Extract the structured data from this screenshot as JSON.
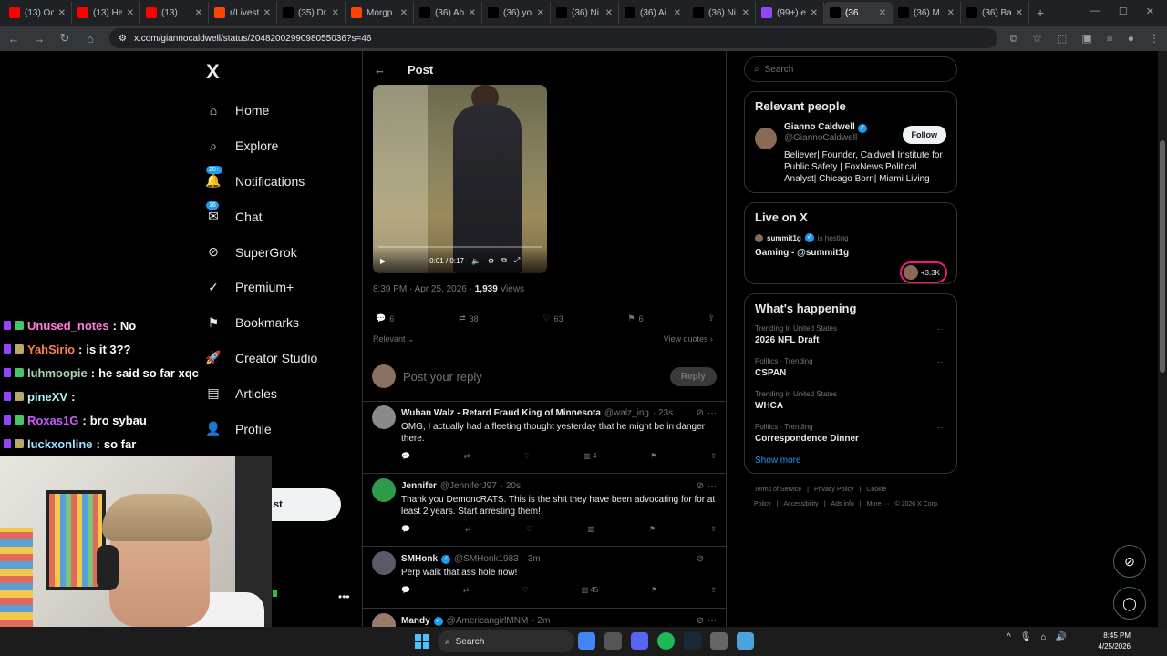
{
  "browser": {
    "tabs": [
      {
        "title": "(13) Oc",
        "favicon": "youtube-icon",
        "color": "#ff0000"
      },
      {
        "title": "(13) He",
        "favicon": "youtube-icon",
        "color": "#ff0000"
      },
      {
        "title": "(13)",
        "favicon": "youtube-icon",
        "color": "#ff0000"
      },
      {
        "title": "r/Livest",
        "favicon": "reddit-icon",
        "color": "#ff4500"
      },
      {
        "title": "(35) Dr",
        "favicon": "x-icon",
        "color": "#000000"
      },
      {
        "title": "Morgp",
        "favicon": "reddit-icon",
        "color": "#ff4500"
      },
      {
        "title": "(36) Ah",
        "favicon": "x-icon",
        "color": "#000000"
      },
      {
        "title": "(36) yo",
        "favicon": "x-icon",
        "color": "#000000"
      },
      {
        "title": "(36) Ni",
        "favicon": "x-icon",
        "color": "#000000"
      },
      {
        "title": "(36) Ai",
        "favicon": "x-icon",
        "color": "#000000"
      },
      {
        "title": "(36) Ni",
        "favicon": "x-icon",
        "color": "#000000"
      },
      {
        "title": "(99+) e",
        "favicon": "twitch-icon",
        "color": "#9146ff"
      },
      {
        "title": "(36",
        "favicon": "x-icon",
        "color": "#000000",
        "active": true
      },
      {
        "title": "(36) M",
        "favicon": "x-icon",
        "color": "#000000"
      },
      {
        "title": "(36) Ba",
        "favicon": "x-icon",
        "color": "#000000"
      }
    ],
    "url": "x.com/giannocaldwell/status/2048200299098055036?s=46"
  },
  "sidebar": {
    "logo": "X",
    "items": [
      {
        "label": "Home",
        "icon": "home-icon"
      },
      {
        "label": "Explore",
        "icon": "search-icon"
      },
      {
        "label": "Notifications",
        "icon": "bell-icon",
        "badge": "20+"
      },
      {
        "label": "Chat",
        "icon": "chat-icon",
        "badge": "16"
      },
      {
        "label": "SuperGrok",
        "icon": "grok-icon"
      },
      {
        "label": "Premium+",
        "icon": "premium-icon"
      },
      {
        "label": "Bookmarks",
        "icon": "bookmark-icon"
      },
      {
        "label": "Creator Studio",
        "icon": "rocket-icon"
      },
      {
        "label": "Articles",
        "icon": "article-icon"
      },
      {
        "label": "Profile",
        "icon": "person-icon"
      }
    ],
    "post_button": "st"
  },
  "post": {
    "header": "Post",
    "video_time": "0:01 / 0:17",
    "timestamp": "8:39 PM · Apr 25, 2026 ·",
    "views_count": "1,939",
    "views_label": "Views",
    "replies": "6",
    "reposts": "38",
    "likes": "63",
    "bookmarks": "6",
    "sort_label": "Relevant",
    "view_quotes": "View quotes",
    "reply_placeholder": "Post your reply",
    "reply_button": "Reply"
  },
  "replies": [
    {
      "name": "Wuhan Walz - Retard Fraud King of Minnesota",
      "handle": "@walz_ing",
      "time": "· 23s",
      "text": "OMG, I actually had a fleeting thought yesterday that he might be in danger there.",
      "views": "4",
      "avatar_color": "#8a8a8a",
      "verified": false
    },
    {
      "name": "Jennifer",
      "handle": "@JenniferJ97",
      "time": "· 20s",
      "text": "Thank you DemoncRATS. This is the shit they have been advocating for for at least 2 years. Start arresting them!",
      "views": "",
      "avatar_color": "#2e9b4a",
      "verified": false
    },
    {
      "name": "SMHonk",
      "handle": "@SMHonk1983",
      "time": "· 3m",
      "text": "Perp walk that ass hole now!",
      "views": "45",
      "avatar_color": "#5a5a6a",
      "verified": true
    },
    {
      "name": "Mandy",
      "handle": "@AmericangirlMNM",
      "time": "· 2m",
      "text": "",
      "views": "",
      "avatar_color": "#9a7a6a",
      "verified": true
    }
  ],
  "right": {
    "search_placeholder": "Search",
    "relevant_people": {
      "title": "Relevant people",
      "name": "Gianno Caldwell",
      "handle": "@GiannoCaldwell",
      "follow": "Follow",
      "bio": "Believer| Founder, Caldwell Institute for Public Safety | FoxNews Political Analyst| Chicago Born| Miami Living"
    },
    "live": {
      "title": "Live on X",
      "host": "summit1g",
      "hosting": "is hosting",
      "stream_title": "Gaming - @summit1g",
      "listeners": "+3.3K"
    },
    "happening": {
      "title": "What's happening",
      "trends": [
        {
          "meta": "Trending in United States",
          "name": "2026 NFL Draft"
        },
        {
          "meta": "Politics · Trending",
          "name": "CSPAN"
        },
        {
          "meta": "Trending in United States",
          "name": "WHCA"
        },
        {
          "meta": "Politics · Trending",
          "name": "Correspondence Dinner"
        }
      ],
      "show_more": "Show more"
    },
    "footer": [
      "Terms of Service",
      "|",
      "Privacy Policy",
      "|",
      "Cookie Policy",
      "|",
      "Accessibility",
      "|",
      "Ads info",
      "|",
      "More ···",
      "© 2026 X Corp."
    ]
  },
  "twitch_chat": [
    {
      "user": "Unused_notes",
      "msg": "No",
      "color": "#ff7fdb"
    },
    {
      "user": "YahSirio",
      "msg": "is it 3??",
      "color": "#ff7f50"
    },
    {
      "user": "luhmoopie",
      "msg": "he said so far xqc",
      "color": "#a9d6b1"
    },
    {
      "user": "pineXV",
      "msg": "",
      "color": "#b0f7ff"
    },
    {
      "user": "Roxas1G",
      "msg": "bro sybau",
      "color": "#c95cff"
    },
    {
      "user": "luckxonline",
      "msg": "so far",
      "color": "#9fe3ff"
    }
  ],
  "taskbar": {
    "search": "Search",
    "time": "8:45 PM",
    "date": "4/25/2026"
  }
}
